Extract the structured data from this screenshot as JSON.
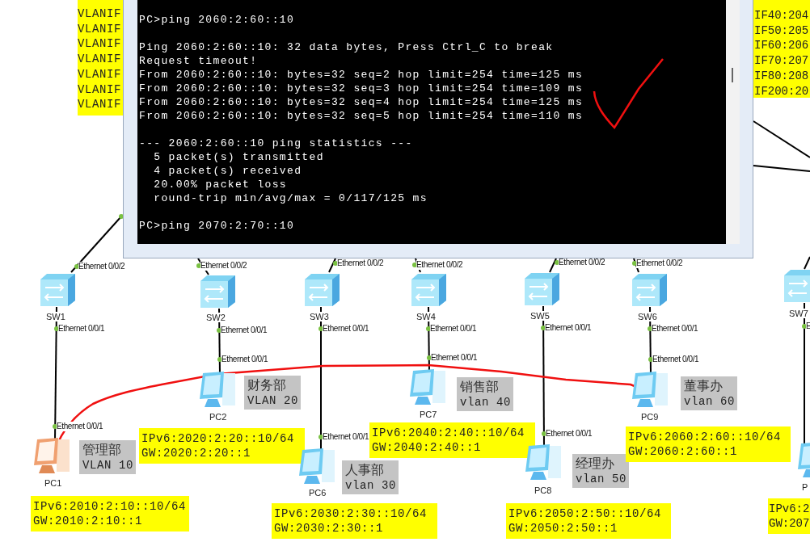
{
  "left_config_note": {
    "lines": [
      "VLANIF",
      "VLANIF",
      "VLANIF",
      "VLANIF",
      "VLANIF",
      "VLANIF",
      "VLANIF"
    ]
  },
  "right_config_note": {
    "lines": [
      "IF40:204",
      "IF50:205",
      "IF60:206",
      "IF70:207",
      "IF80:208",
      "IF200:20"
    ]
  },
  "terminal": {
    "blocks": [
      [
        "PC>ping 2060:2:60::10"
      ],
      [
        "Ping 2060:2:60::10: 32 data bytes, Press Ctrl_C to break",
        "Request timeout!",
        "From 2060:2:60::10: bytes=32 seq=2 hop limit=254 time=125 ms",
        "From 2060:2:60::10: bytes=32 seq=3 hop limit=254 time=109 ms",
        "From 2060:2:60::10: bytes=32 seq=4 hop limit=254 time=125 ms",
        "From 2060:2:60::10: bytes=32 seq=5 hop limit=254 time=110 ms"
      ],
      [
        "--- 2060:2:60::10 ping statistics ---",
        "  5 packet(s) transmitted",
        "  4 packet(s) received",
        "  20.00% packet loss",
        "  round-trip min/avg/max = 0/117/125 ms"
      ],
      [
        "PC>ping 2070:2:70::10"
      ]
    ]
  },
  "switches": [
    {
      "label": "SW1",
      "uplink_port": "Ethernet 0/0/2",
      "downlink_port": "Ethernet 0/0/1"
    },
    {
      "label": "SW2",
      "uplink_port": "Ethernet 0/0/2",
      "downlink_port": "Ethernet 0/0/1"
    },
    {
      "label": "SW3",
      "uplink_port": "Ethernet 0/0/2",
      "downlink_port": "Ethernet 0/0/1"
    },
    {
      "label": "SW4",
      "uplink_port": "Ethernet 0/0/2",
      "downlink_port": "Ethernet 0/0/1"
    },
    {
      "label": "SW5",
      "uplink_port": "Ethernet 0/0/2",
      "downlink_port": "Ethernet 0/0/1"
    },
    {
      "label": "SW6",
      "uplink_port": "Ethernet 0/0/2",
      "downlink_port": "Ethernet 0/0/1"
    },
    {
      "label": "SW7",
      "downlink_port": "E"
    }
  ],
  "hosts": [
    {
      "label": "PC1",
      "selected": true,
      "port": "Ethernet 0/0/1",
      "department": "管理部",
      "vlan": "VLAN 10",
      "ipv6": "IPv6:2010:2:10::10/64",
      "gateway": "GW:2010:2:10::1"
    },
    {
      "label": "PC2",
      "selected": false,
      "port": "Ethernet 0/0/1",
      "department": "财务部",
      "vlan": "VLAN 20",
      "ipv6": "IPv6:2020:2:20::10/64",
      "gateway": "GW:2020:2:20::1"
    },
    {
      "label": "PC6",
      "selected": false,
      "port": "Ethernet 0/0/1",
      "department": "人事部",
      "vlan": "vlan 30",
      "ipv6": "IPv6:2030:2:30::10/64",
      "gateway": "GW:2030:2:30::1"
    },
    {
      "label": "PC7",
      "selected": false,
      "port": "Ethernet 0/0/1",
      "department": "销售部",
      "vlan": "vlan 40",
      "ipv6": "IPv6:2040:2:40::10/64",
      "gateway": "GW:2040:2:40::1"
    },
    {
      "label": "PC8",
      "selected": false,
      "port": "Ethernet 0/0/1",
      "department": "经理办",
      "vlan": "vlan 50",
      "ipv6": "IPv6:2050:2:50::10/64",
      "gateway": "GW:2050:2:50::1"
    },
    {
      "label": "PC9",
      "selected": false,
      "port": "Ethernet 0/0/1",
      "department": "董事办",
      "vlan": "vlan 60",
      "ipv6": "IPv6:2060:2:60::10/64",
      "gateway": "GW:2060:2:60::1"
    },
    {
      "label": "P",
      "selected": false,
      "ipv6": "IPv6:2",
      "gateway": "GW:207"
    }
  ]
}
